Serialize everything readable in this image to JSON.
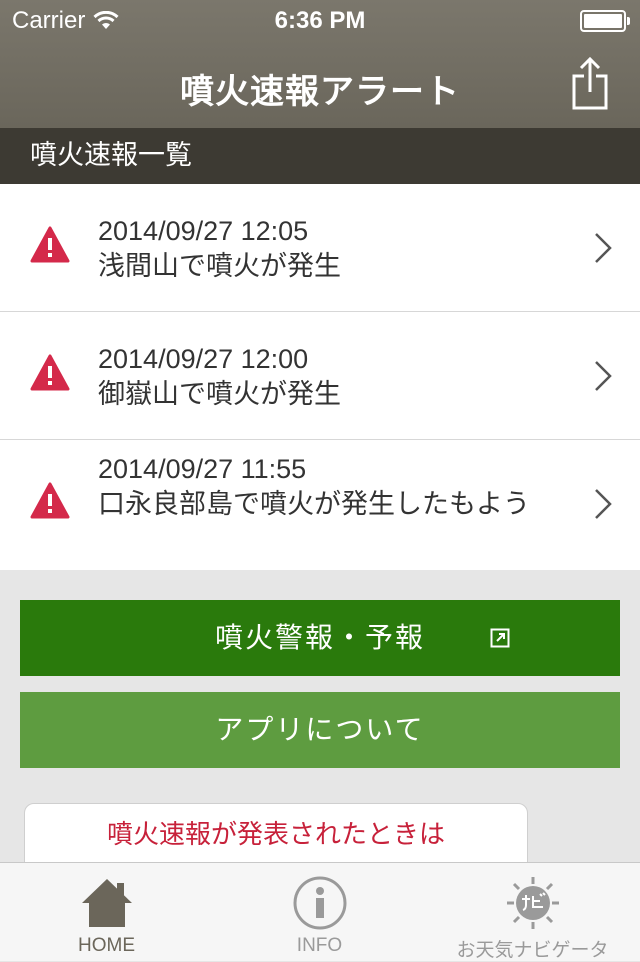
{
  "status_bar": {
    "carrier": "Carrier",
    "time": "6:36 PM"
  },
  "nav": {
    "title": "噴火速報アラート",
    "share_icon": "share-icon"
  },
  "section": {
    "title": "噴火速報一覧"
  },
  "alerts": [
    {
      "datetime": "2014/09/27 12:05",
      "message": "浅間山で噴火が発生"
    },
    {
      "datetime": "2014/09/27 12:00",
      "message": "御嶽山で噴火が発生"
    },
    {
      "datetime": "2014/09/27 11:55",
      "message": "口永良部島で噴火が発生したもよう"
    }
  ],
  "buttons": {
    "alerts_forecast": "噴火警報・予報",
    "about_app": "アプリについて"
  },
  "notice": {
    "text": "噴火速報が発表されたときは"
  },
  "tabs": [
    {
      "label": "HOME",
      "icon": "home-icon"
    },
    {
      "label": "INFO",
      "icon": "info-icon"
    },
    {
      "label": "お天気ナビゲータ",
      "icon": "weather-navi-icon"
    }
  ],
  "colors": {
    "nav_bar": "#736f63",
    "section_header": "#3d3a33",
    "alert_icon": "#d4294a",
    "primary_button": "#2a7a0c",
    "secondary_button": "#5e9c40",
    "notice_text": "#c7213a"
  }
}
